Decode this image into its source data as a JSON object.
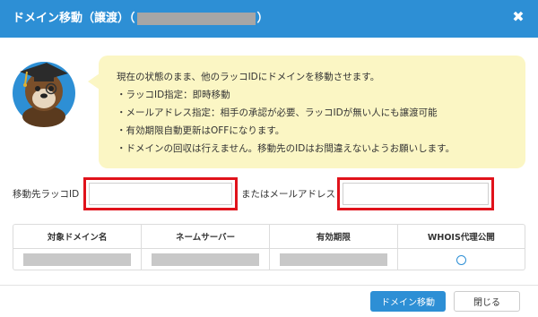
{
  "dialog": {
    "title_prefix": "ドメイン移動（譲渡）（",
    "title_suffix": "）"
  },
  "notice": {
    "lines": [
      "現在の状態のまま、他のラッコIDにドメインを移動させます。",
      "・ラッコID指定：即時移動",
      "・メールアドレス指定：相手の承認が必要、ラッコIDが無い人にも譲渡可能",
      "・有効期限自動更新はOFFになります。",
      "・ドメインの回収は行えません。移動先のIDはお間違えないようお願いします。"
    ]
  },
  "form": {
    "id_label": "移動先ラッコID",
    "or_email_label": "またはメールアドレス",
    "id_value": "",
    "email_value": ""
  },
  "table": {
    "headers": [
      "対象ドメイン名",
      "ネームサーバー",
      "有効期限",
      "WHOIS代理公開"
    ],
    "whois_mark": "○"
  },
  "buttons": {
    "move": "ドメイン移動",
    "close": "閉じる"
  },
  "icons": {
    "close": "close-icon",
    "mascot": "otter-mascot-icon",
    "whois": "circle-status-icon"
  },
  "colors": {
    "accent": "#2d8fd5",
    "notice_bg": "#fbf6c4",
    "highlight": "#e0121b"
  }
}
